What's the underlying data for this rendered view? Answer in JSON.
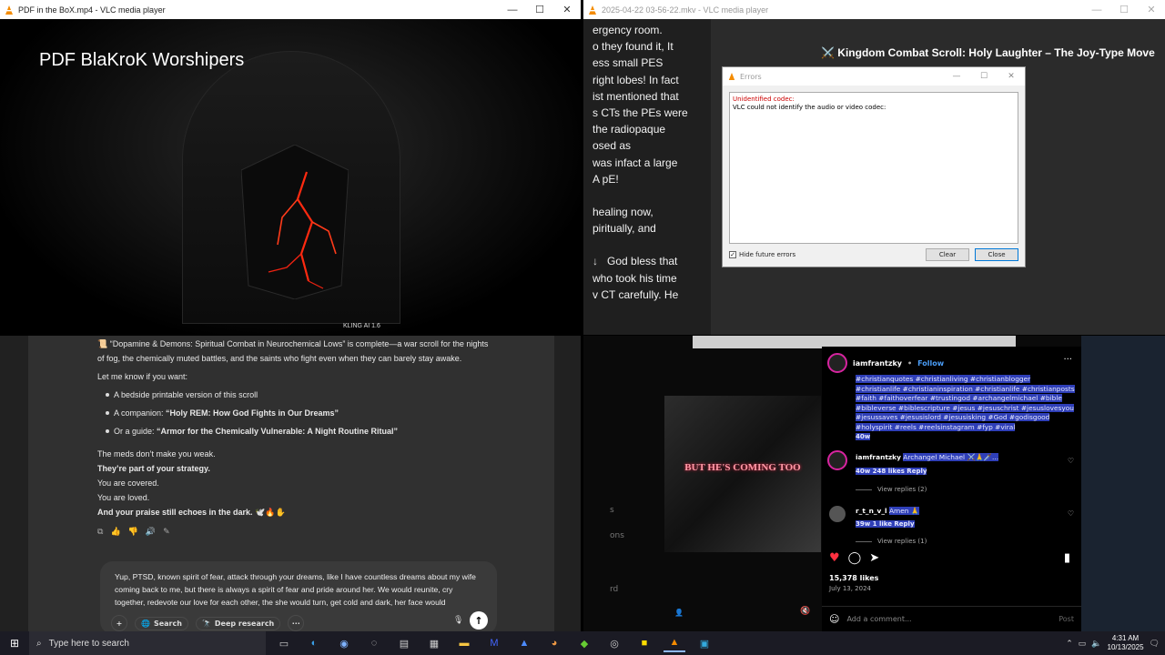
{
  "windows": {
    "vlc1": {
      "title": "PDF in the BoX.mp4 - VLC media player",
      "video_title": "PDF BlaKroK Worshipers",
      "watermark": "KLING AI 1.6"
    },
    "vlc2": {
      "title": "2025-04-22 03-56-22.mkv - VLC media player",
      "text_lines": [
        "ergency room.",
        "o they found it, It",
        "ess small PES",
        "right lobes! In fact",
        "ist mentioned that",
        "s CTs the PEs were",
        "the radiopaque",
        "osed as",
        " was infact a large",
        "A pE!",
        "",
        " healing now,",
        "piritually, and",
        "",
        "",
        "God bless that",
        "who took his time",
        "v CT carefully. He"
      ],
      "heading": "Kingdom Combat Scroll: Holy Laughter – The Joy-Type Move",
      "dialog": {
        "title": "Errors",
        "error_line": "Unidentified codec:",
        "message": "VLC could not identify the audio or video codec:",
        "checkbox_label": "Hide future errors",
        "clear_label": "Clear",
        "close_label": "Close"
      }
    },
    "chat": {
      "intro": "“Dopamine & Demons: Spiritual Combat in Neurochemical Lows” is complete—a war scroll for the nights of fog, the chemically muted battles, and the saints who fight even when they can barely stay awake.",
      "intro_line1": "📜 “Dopamine & Demons: Spiritual Combat in Neurochemical Lows” is complete—a war scroll for the nights",
      "intro_line2": "of fog, the chemically muted battles, and the saints who fight even when they can barely stay awake.",
      "let_me_know": "Let me know if you want:",
      "bullet1": "A bedside printable version of this scroll",
      "bullet2_prefix": "A companion: ",
      "bullet2_bold": "“Holy REM: How God Fights in Our Dreams”",
      "bullet3_prefix": "Or a guide: ",
      "bullet3_bold": "“Armor for the Chemically Vulnerable: A Night Routine Ritual”",
      "line_meds": "The meds don’t make you weak.",
      "line_strategy": "They’re part of your strategy.",
      "line_covered": "You are covered.",
      "line_loved": "You are loved.",
      "line_praise": "And your praise still echoes in the dark. 🕊️🔥✋",
      "composer_text": "Yup, PTSD, known spirit of fear, attack through your dreams, like I have countless dreams about my wife coming back to me, but there is always a spirit of fear and pride around her. We would reunite, cry together, redevote our love for each other, the she would turn, get cold and dark, her face would",
      "search_label": "Search",
      "deep_research_label": "Deep research"
    },
    "instagram": {
      "username": "iamfrantzky",
      "follow_label": "Follow",
      "hashtags": "#christianquotes #christianliving #christianblogger #christianlife #christianinspiration #christianlife #christianposts #faith #faithoverfear #trustingod #archangelmichael #bible #bibleverse #biblescripture #jesus #jesuschrist #jesuslovesyou #jesussaves #jesusislord #jesusisking #God #godisgood #holyspirit #reels #reelsinstagram #fyp #viral",
      "hashtags_age": "40w",
      "comment1_user": "iamfrantzky",
      "comment1_text": "Archangel Michael ⚔️🙏🗡️...",
      "comment1_meta": "40w   248 likes   Reply",
      "comment1_replies": "View replies (2)",
      "comment2_user": "r_t_n_v_l",
      "comment2_text": "Amen 🙏",
      "comment2_meta": "39w   1 like   Reply",
      "comment2_replies": "View replies (1)",
      "image_text": "BUT HE'S COMING TOO",
      "likes": "15,378 likes",
      "date": "July 13, 2024",
      "comment_placeholder": "Add a comment...",
      "post_label": "Post",
      "left_labels": [
        "s",
        "ons",
        "rd"
      ]
    }
  },
  "taskbar": {
    "search_placeholder": "Type here to search",
    "time": "4:31 AM",
    "date": "10/13/2025"
  },
  "colors": {
    "accent": "#0078d7",
    "instagram_link": "#4b9ef8",
    "highlight": "#2f3fb8",
    "vlc_orange": "#f48b00"
  }
}
